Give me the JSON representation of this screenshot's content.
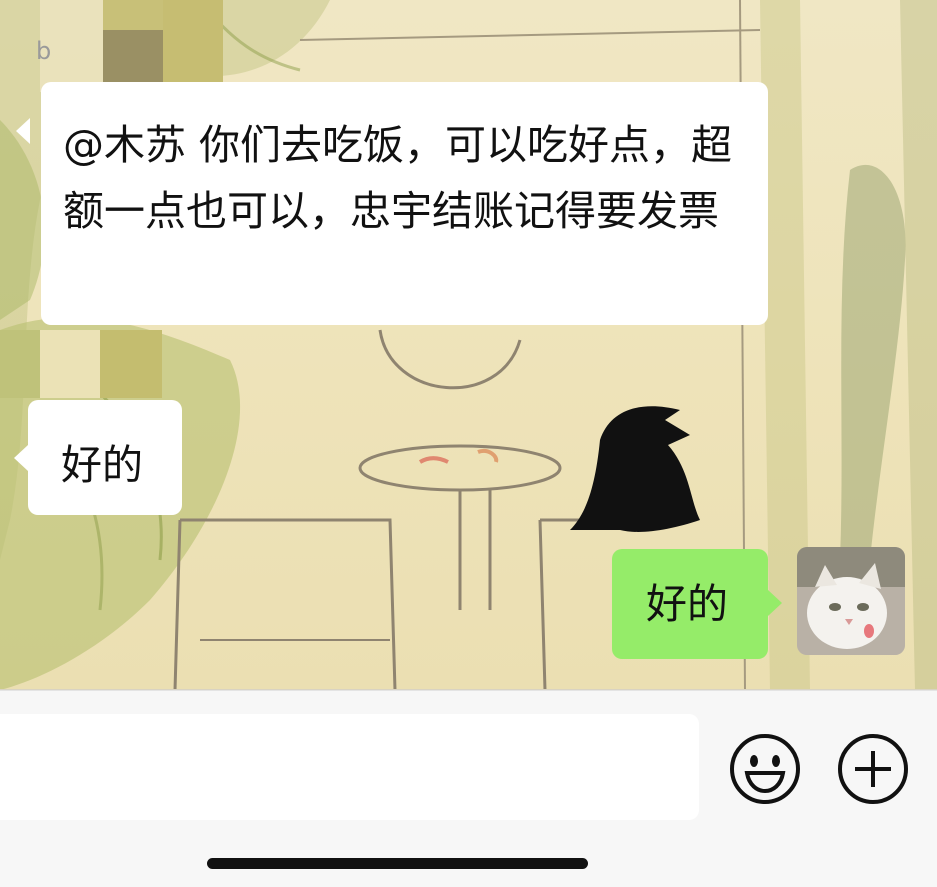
{
  "chat": {
    "header_fragment": "b",
    "messages": [
      {
        "direction": "incoming",
        "text": "@木苏  你们去吃饭，可以吃好点，超额一点也可以，忠宇结账记得要发票"
      },
      {
        "direction": "incoming",
        "text": "好的"
      },
      {
        "direction": "outgoing",
        "text": "好的"
      }
    ],
    "self_avatar_icon": "cat-photo-avatar",
    "colors": {
      "incoming_bubble": "#ffffff",
      "outgoing_bubble": "#95ec69",
      "input_bar": "#f7f7f7"
    }
  },
  "input_bar": {
    "text_value": "",
    "emoji_icon": "smiley-face-icon",
    "plus_icon": "plus-circle-icon"
  }
}
